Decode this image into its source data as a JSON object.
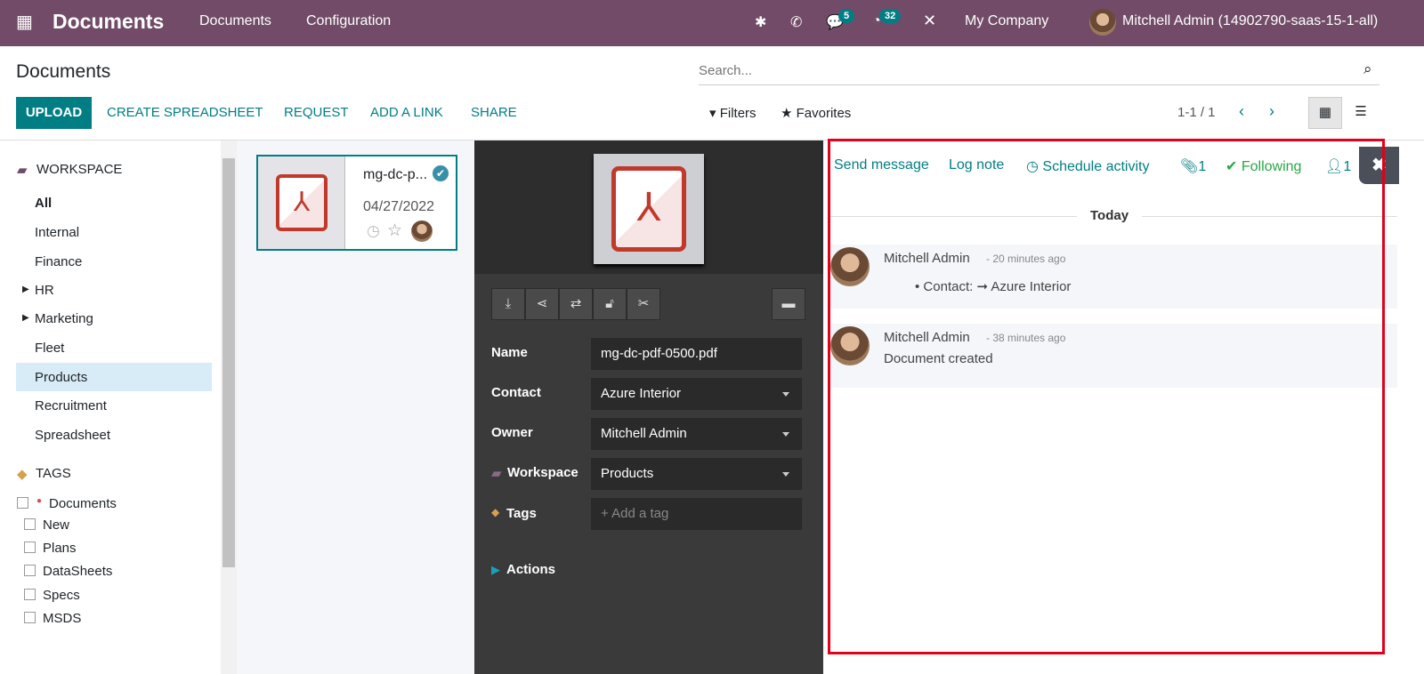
{
  "topbar": {
    "app": "Documents",
    "menu": [
      "Documents",
      "Configuration"
    ],
    "chat_count": "5",
    "activity_count": "32",
    "company": "My Company",
    "user": "Mitchell Admin (14902790-saas-15-1-all)"
  },
  "control": {
    "title": "Documents",
    "search_placeholder": "Search...",
    "buttons": [
      "UPLOAD",
      "CREATE SPREADSHEET",
      "REQUEST",
      "ADD A LINK",
      "SHARE"
    ],
    "filters": "Filters",
    "favorites": "Favorites",
    "pager": "1-1 / 1"
  },
  "sidebar": {
    "workspace_header": "WORKSPACE",
    "items": [
      "All",
      "Internal",
      "Finance",
      "HR",
      "Marketing",
      "Fleet",
      "Products",
      "Recruitment",
      "Spreadsheet"
    ],
    "selected": "Products",
    "tags_header": "TAGS",
    "tags": [
      "Documents",
      "New",
      "Plans",
      "DataSheets",
      "Specs",
      "MSDS"
    ]
  },
  "card": {
    "name": "mg-dc-p...",
    "date": "04/27/2022"
  },
  "inspector": {
    "fields": [
      {
        "label": "Name",
        "value": "mg-dc-pdf-0500.pdf"
      },
      {
        "label": "Contact",
        "value": "Azure Interior"
      },
      {
        "label": "Owner",
        "value": "Mitchell Admin"
      },
      {
        "label": "Workspace",
        "value": "Products"
      },
      {
        "label": "Tags",
        "value": "+ Add a tag"
      }
    ],
    "actions": "Actions"
  },
  "chatter": {
    "send": "Send message",
    "log": "Log note",
    "schedule": "Schedule activity",
    "attachments": "1",
    "following": "Following",
    "followers": "1",
    "date_sep": "Today",
    "messages": [
      {
        "author": "Mitchell Admin",
        "time": "- 20 minutes ago",
        "body_label": "Contact:",
        "body_value": "Azure Interior"
      },
      {
        "author": "Mitchell Admin",
        "time": "- 38 minutes ago",
        "body": "Document created"
      }
    ]
  },
  "colors": {
    "brand": "#714B67",
    "accent": "#017e84",
    "highlight": "#e2001a"
  }
}
